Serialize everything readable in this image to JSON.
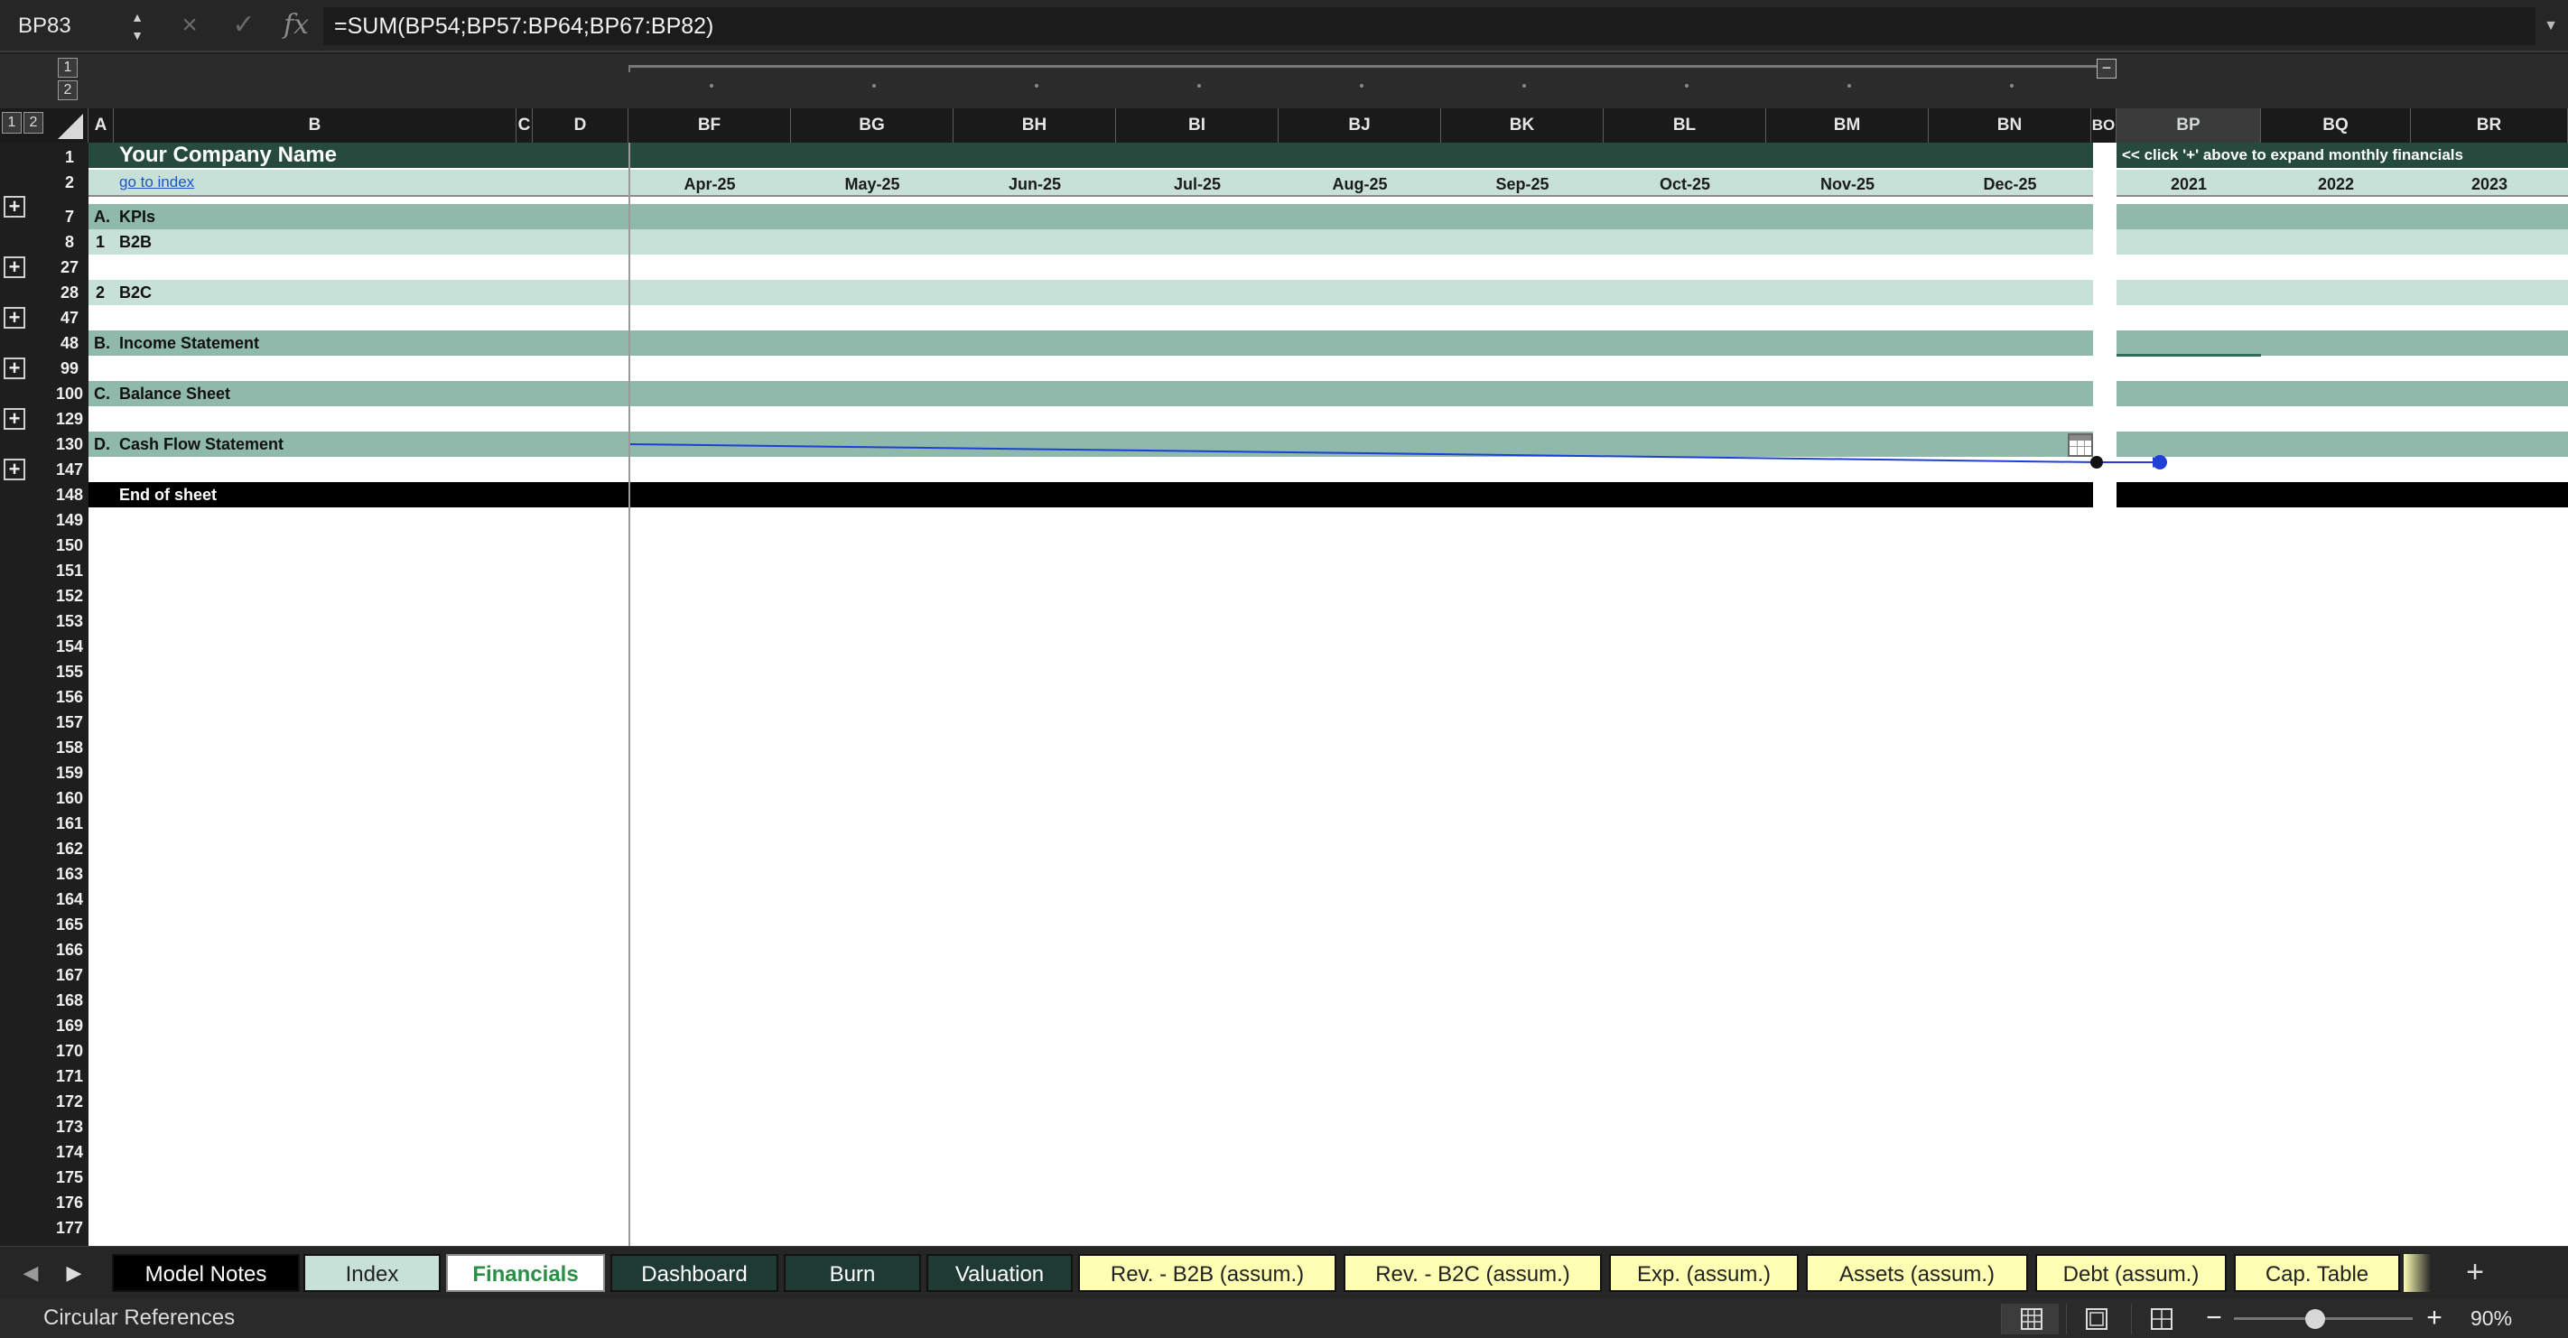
{
  "formula_bar": {
    "cell_ref": "BP83",
    "cancel_icon": "×",
    "enter_icon": "✓",
    "fx_label": "fx",
    "formula": "=SUM(BP54;BP57:BP64;BP67:BP82)"
  },
  "outline": {
    "col_levels": [
      "1",
      "2"
    ],
    "row_levels": [
      "1",
      "2"
    ],
    "collapse_icon": "−"
  },
  "columns": [
    "A",
    "B",
    "C",
    "D",
    "BF",
    "BG",
    "BH",
    "BI",
    "BJ",
    "BK",
    "BL",
    "BM",
    "BN",
    "BO",
    "BP",
    "BQ",
    "BR"
  ],
  "rows": [
    "1",
    "2",
    "7",
    "8",
    "27",
    "28",
    "47",
    "48",
    "99",
    "100",
    "129",
    "130",
    "147",
    "148",
    "149",
    "150",
    "151",
    "152",
    "153",
    "154",
    "155",
    "156",
    "157",
    "158",
    "159",
    "160",
    "161",
    "162",
    "163",
    "164",
    "165",
    "166",
    "167",
    "168",
    "169",
    "170",
    "171",
    "172",
    "173",
    "174",
    "175",
    "176",
    "177"
  ],
  "sheet": {
    "company_name": "Your Company Name",
    "go_to_index": "go to index",
    "expand_hint": "<< click '+' above to expand monthly financials",
    "months": [
      "Apr-25",
      "May-25",
      "Jun-25",
      "Jul-25",
      "Aug-25",
      "Sep-25",
      "Oct-25",
      "Nov-25",
      "Dec-25"
    ],
    "years": [
      "2021",
      "2022",
      "2023"
    ],
    "sections": [
      {
        "letter": "A.",
        "label": "KPIs"
      },
      {
        "letter": "1",
        "label": "B2B"
      },
      {
        "letter": "2",
        "label": "B2C"
      },
      {
        "letter": "B.",
        "label": "Income Statement"
      },
      {
        "letter": "C.",
        "label": "Balance Sheet"
      },
      {
        "letter": "D.",
        "label": "Cash Flow Statement"
      }
    ],
    "end_label": "End of sheet"
  },
  "tabs": [
    {
      "label": "Model Notes",
      "style": "k"
    },
    {
      "label": "Index",
      "style": "lt"
    },
    {
      "label": "Financials",
      "style": "act"
    },
    {
      "label": "Dashboard",
      "style": "dg"
    },
    {
      "label": "Burn",
      "style": "dg"
    },
    {
      "label": "Valuation",
      "style": "dg"
    },
    {
      "label": "Rev. - B2B (assum.)",
      "style": "ye"
    },
    {
      "label": "Rev. - B2C (assum.)",
      "style": "ye"
    },
    {
      "label": "Exp. (assum.)",
      "style": "ye"
    },
    {
      "label": "Assets (assum.)",
      "style": "ye"
    },
    {
      "label": "Debt (assum.)",
      "style": "ye"
    },
    {
      "label": "Cap. Table",
      "style": "ye"
    }
  ],
  "add_sheet_icon": "+",
  "status": {
    "text": "Circular References",
    "zoom": "90%",
    "zoom_level_percent": 90
  },
  "colors": {
    "header_dark": "#264a3e",
    "section_mid": "#8fb9ab",
    "section_light": "#c7e0d8",
    "assumption_tab": "#ffffb3",
    "link": "#1a56c4",
    "trace_arrow": "#1f3fd6"
  }
}
